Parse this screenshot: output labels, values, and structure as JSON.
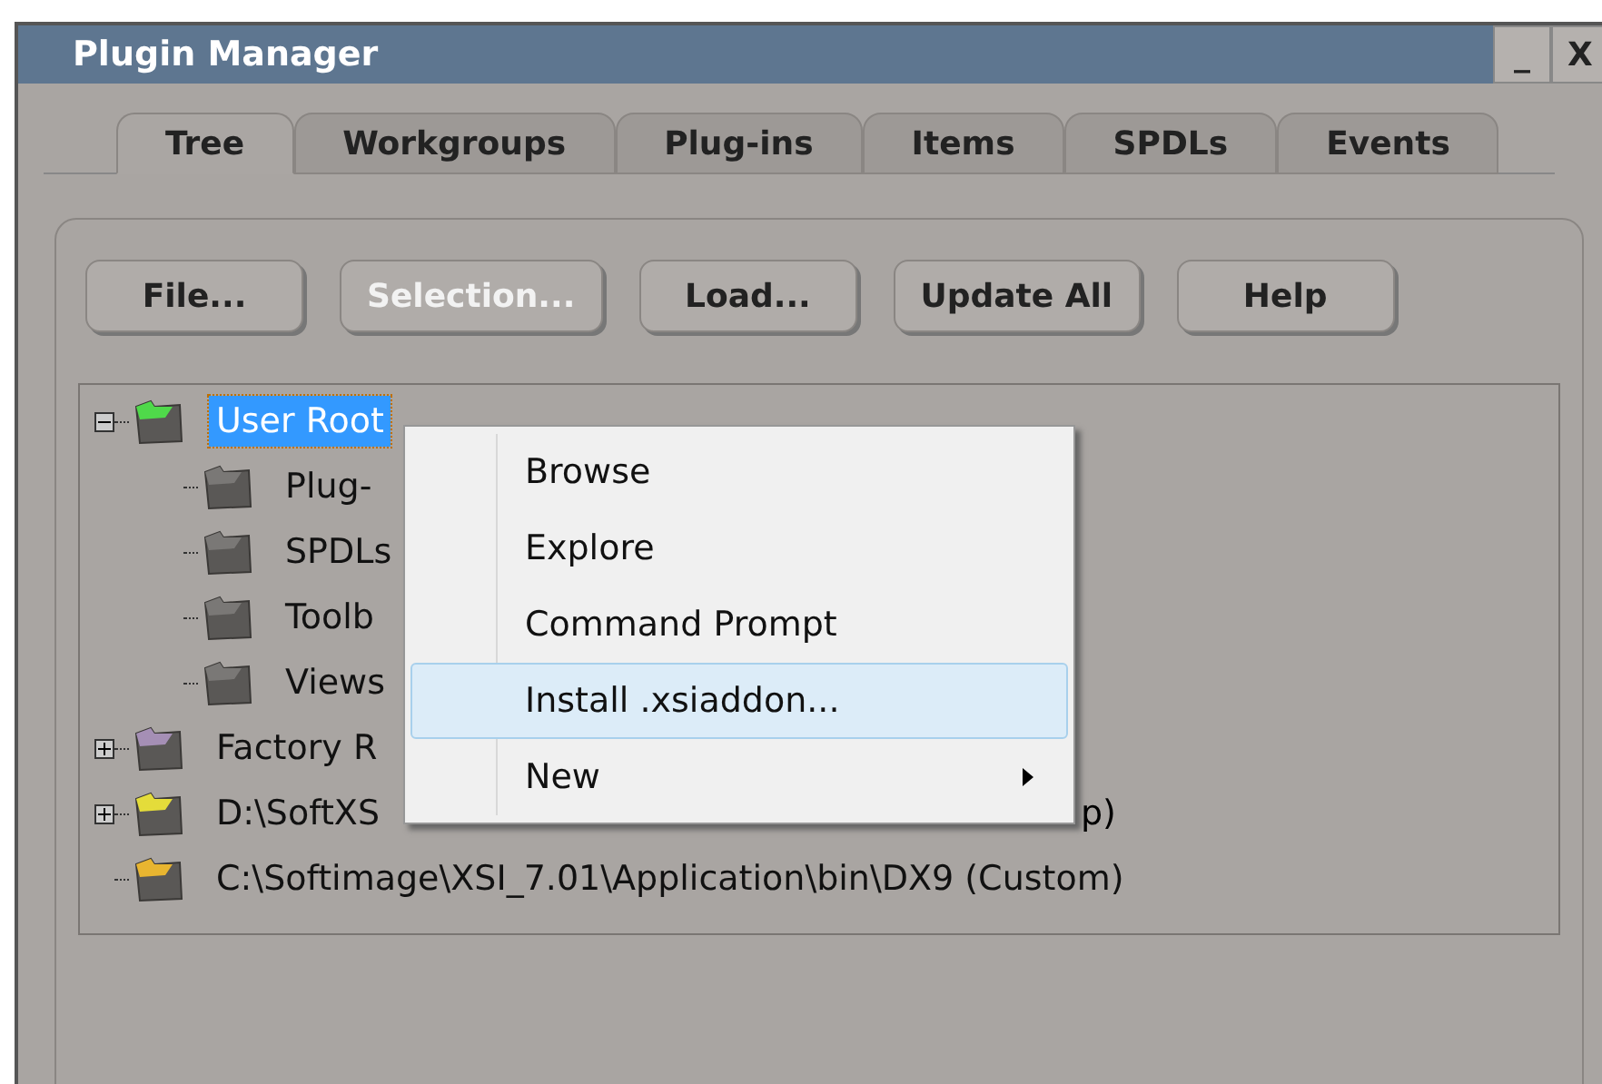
{
  "window": {
    "title": "Plugin Manager",
    "controls": [
      "_",
      "X"
    ]
  },
  "tabs": [
    {
      "label": "Tree",
      "selected": true
    },
    {
      "label": "Workgroups",
      "selected": false
    },
    {
      "label": "Plug-ins",
      "selected": false
    },
    {
      "label": "Items",
      "selected": false
    },
    {
      "label": "SPDLs",
      "selected": false
    },
    {
      "label": "Events",
      "selected": false
    }
  ],
  "buttons": [
    {
      "label": "File...",
      "disabled": false
    },
    {
      "label": "Selection...",
      "disabled": true
    },
    {
      "label": "Load...",
      "disabled": false
    },
    {
      "label": "Update All",
      "disabled": false
    },
    {
      "label": "Help",
      "disabled": false
    }
  ],
  "tree": [
    {
      "label": "User Root",
      "kind": "branch",
      "expanded": true,
      "selected": true,
      "color": "#4fd94a",
      "children": [
        {
          "label": "Plug-",
          "kind": "leaf",
          "selected": false,
          "color": "#7a7876"
        },
        {
          "label": "SPDLs",
          "kind": "leaf",
          "selected": false,
          "color": "#7a7876"
        },
        {
          "label": "Toolb",
          "kind": "leaf",
          "selected": false,
          "color": "#7a7876"
        },
        {
          "label": "Views",
          "kind": "leaf",
          "selected": false,
          "color": "#7a7876"
        }
      ]
    },
    {
      "label": "Factory R",
      "kind": "branch",
      "expanded": false,
      "selected": false,
      "color": "#a58fb5"
    },
    {
      "label": "D:\\SoftXS",
      "tail": "p)",
      "kind": "branch",
      "expanded": false,
      "selected": false,
      "color": "#e4dc3a"
    },
    {
      "label": "C:\\Softimage\\XSI_7.01\\Application\\bin\\DX9 (Custom)",
      "kind": "leaf",
      "selected": false,
      "color": "#e8b530"
    }
  ],
  "context_menu": [
    {
      "label": "Browse",
      "selected": false,
      "submenu": false
    },
    {
      "label": "Explore",
      "selected": false,
      "submenu": false
    },
    {
      "label": "Command Prompt",
      "selected": false,
      "submenu": false
    },
    {
      "label": "Install .xsiaddon...",
      "selected": true,
      "submenu": false
    },
    {
      "label": "New",
      "selected": false,
      "submenu": true
    }
  ]
}
